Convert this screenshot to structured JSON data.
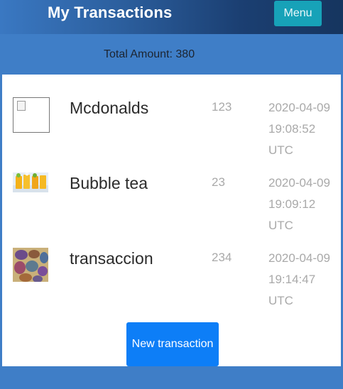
{
  "header": {
    "title": "My Transactions",
    "menu_label": "Menu"
  },
  "summary": {
    "total_label": "Total Amount: 380"
  },
  "transactions": [
    {
      "name": "Mcdonalds",
      "amount": "123",
      "date_line1": "2020-04-09",
      "date_line2": "19:08:52",
      "date_line3": "UTC",
      "icon": "broken-image-icon"
    },
    {
      "name": "Bubble tea",
      "amount": "23",
      "date_line1": "2020-04-09",
      "date_line2": "19:09:12",
      "date_line3": "UTC",
      "icon": "drinks-photo"
    },
    {
      "name": "transaccion",
      "amount": "234",
      "date_line1": "2020-04-09",
      "date_line2": "19:14:47",
      "date_line3": "UTC",
      "icon": "stones-photo"
    }
  ],
  "actions": {
    "new_transaction_label": "New transaction"
  },
  "colors": {
    "header_start": "#3a78c2",
    "header_end": "#16355f",
    "menu_button": "#17a2b8",
    "bar": "#3f7ec7",
    "primary_button": "#0d7ef7"
  }
}
